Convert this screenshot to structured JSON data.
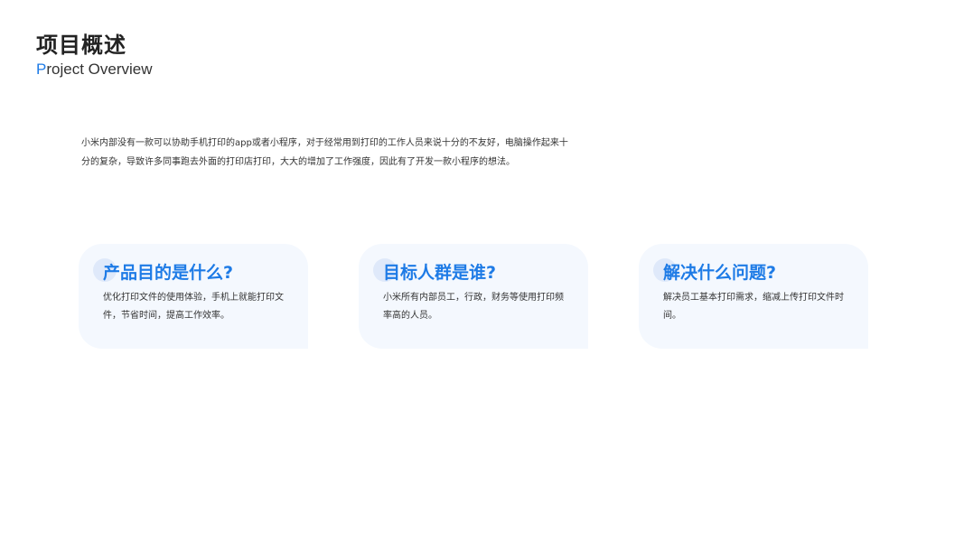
{
  "header": {
    "title": "项目概述",
    "subtitle_first_letter": "P",
    "subtitle_rest": "roject Overview"
  },
  "intro": {
    "text": "小米内部没有一款可以协助手机打印的app或者小程序，对于经常用到打印的工作人员来说十分的不友好，电脑操作起来十分的复杂，导致许多同事跑去外面的打印店打印，大大的增加了工作强度，因此有了开发一款小程序的想法。"
  },
  "cards": [
    {
      "title": "产品目的是什么?",
      "body": "优化打印文件的使用体验，手机上就能打印文件，节省时间，提高工作效率。"
    },
    {
      "title": "目标人群是谁?",
      "body": "小米所有内部员工，行政，财务等使用打印频率高的人员。"
    },
    {
      "title": "解决什么问题?",
      "body": "解决员工基本打印需求，缩减上传打印文件时间。"
    }
  ],
  "colors": {
    "accent": "#1e7be6",
    "card_background": "#f4f8fe",
    "text": "#333333"
  }
}
